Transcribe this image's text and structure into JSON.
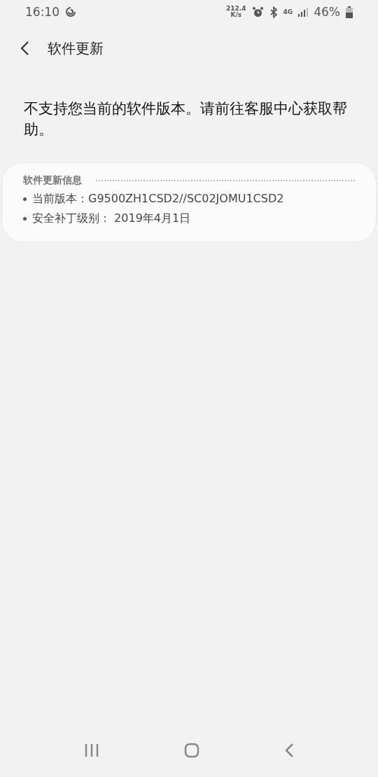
{
  "status_bar": {
    "time": "16:10",
    "net_speed": "212.4",
    "net_speed_unit": "K/s",
    "network": "4G",
    "battery": "46%"
  },
  "app_bar": {
    "title": "软件更新"
  },
  "message": "不支持您当前的软件版本。请前往客服中心获取帮助。",
  "info_card": {
    "title": "软件更新信息",
    "items": [
      "当前版本：G9500ZH1CSD2//SC02JOMU1CSD2",
      "安全补丁级别： 2019年4月1日"
    ]
  },
  "nav_bar": {
    "buttons": [
      {
        "kind": "recents"
      },
      {
        "kind": "home"
      },
      {
        "kind": "back"
      }
    ]
  }
}
